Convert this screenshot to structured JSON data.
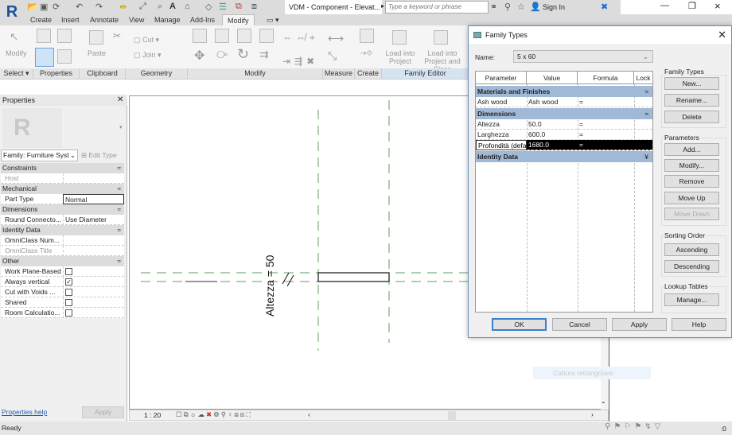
{
  "app": {
    "title": "VDM - Component - Elevat...",
    "search_placeholder": "Type a keyword or phrase",
    "sign_in": "Sign In",
    "logo": "R"
  },
  "quick_access_icons": [
    "open-icon",
    "save-icon",
    "sync-icon",
    "undo-icon",
    "redo-icon",
    "measure-icon",
    "dimension-icon",
    "tag-icon",
    "text-icon",
    "3d-view-icon",
    "section-icon",
    "thin-lines-icon",
    "close-hidden-icon",
    "switch-windows-icon"
  ],
  "ribbon": {
    "tabs": [
      "Create",
      "Insert",
      "Annotate",
      "View",
      "Manage",
      "Add-Ins",
      "Modify"
    ],
    "active_tab": "Modify",
    "buttons": {
      "modify": "Modify",
      "paste": "Paste",
      "cut": "Cut",
      "join": "Join",
      "load_project": "Load into Project",
      "load_project_close": "Load into Project and Close"
    },
    "panels": [
      "Select ▾",
      "Properties",
      "Clipboard",
      "Geometry",
      "Modify",
      "Measure",
      "Create",
      "Family Editor"
    ]
  },
  "properties": {
    "title": "Properties",
    "type_selector": "Family: Furniture Syst",
    "edit_type": "Edit Type",
    "groups": [
      {
        "name": "Constraints",
        "rows": [
          {
            "key": "Host",
            "value": "",
            "disabled": true
          }
        ]
      },
      {
        "name": "Mechanical",
        "rows": [
          {
            "key": "Part Type",
            "value": "Normal"
          }
        ]
      },
      {
        "name": "Dimensions",
        "rows": [
          {
            "key": "Round Connecto...",
            "value": "Use Diameter"
          }
        ]
      },
      {
        "name": "Identity Data",
        "rows": [
          {
            "key": "OmniClass Num...",
            "value": ""
          },
          {
            "key": "OmniClass Title",
            "value": "",
            "disabled": true
          }
        ]
      },
      {
        "name": "Other",
        "rows": [
          {
            "key": "Work Plane-Based",
            "checked": false
          },
          {
            "key": "Always vertical",
            "checked": true
          },
          {
            "key": "Cut with Voids ...",
            "checked": false
          },
          {
            "key": "Shared",
            "checked": false
          },
          {
            "key": "Room Calculatio...",
            "checked": false
          }
        ]
      }
    ],
    "help": "Properties help",
    "apply": "Apply"
  },
  "canvas": {
    "dimension_label": "Altezza = 50",
    "ref_color": "#4a9a4a"
  },
  "view_bar": {
    "scale": "1 : 20"
  },
  "status": {
    "text": "Ready",
    "filter_count": ":0"
  },
  "ghost_tooltip": "Cattura rettangolare",
  "dialog": {
    "title": "Family Types",
    "name_label": "Name:",
    "name_value": "5 x 60",
    "columns": [
      "Parameter",
      "Value",
      "Formula",
      "Lock"
    ],
    "groups": [
      {
        "name": "Materials and Finishes",
        "chevron": "≈",
        "rows": [
          {
            "param": "Ash wood",
            "value": "Ash wood",
            "formula": "=",
            "lock": null
          }
        ]
      },
      {
        "name": "Dimensions",
        "chevron": "≈",
        "rows": [
          {
            "param": "Altezza",
            "value": "50.0",
            "formula": "=",
            "lock": false
          },
          {
            "param": "Larghezza",
            "value": "600.0",
            "formula": "=",
            "lock": false
          },
          {
            "param": "Profondità (default)",
            "value": "1680.0",
            "formula": "=",
            "lock": false,
            "selected": true
          }
        ]
      },
      {
        "name": "Identity Data",
        "chevron": "¥",
        "rows": []
      }
    ],
    "family_types": {
      "label": "Family Types",
      "new": "New...",
      "rename": "Rename...",
      "delete": "Delete"
    },
    "parameters": {
      "label": "Parameters",
      "add": "Add...",
      "modify": "Modify...",
      "remove": "Remove",
      "move_up": "Move Up",
      "move_down": "Move Down"
    },
    "sorting": {
      "label": "Sorting Order",
      "asc": "Ascending",
      "desc": "Descending"
    },
    "lookup": {
      "label": "Lookup Tables",
      "manage": "Manage..."
    },
    "footer": {
      "ok": "OK",
      "cancel": "Cancel",
      "apply": "Apply",
      "help": "Help"
    }
  }
}
